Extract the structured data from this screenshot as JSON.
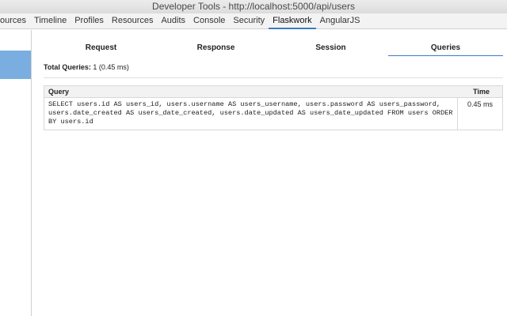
{
  "window": {
    "title": "Developer Tools - http://localhost:5000/api/users"
  },
  "devtools_tabs": [
    {
      "label": "ources",
      "active": false
    },
    {
      "label": "Timeline",
      "active": false
    },
    {
      "label": "Profiles",
      "active": false
    },
    {
      "label": "Resources",
      "active": false
    },
    {
      "label": "Audits",
      "active": false
    },
    {
      "label": "Console",
      "active": false
    },
    {
      "label": "Security",
      "active": false
    },
    {
      "label": "Flaskwork",
      "active": true
    },
    {
      "label": "AngularJS",
      "active": false
    }
  ],
  "panel": {
    "subtabs": [
      {
        "label": "Request",
        "active": false
      },
      {
        "label": "Response",
        "active": false
      },
      {
        "label": "Session",
        "active": false
      },
      {
        "label": "Queries",
        "active": true
      }
    ],
    "summary": {
      "label": "Total Queries:",
      "value": "1 (0.45 ms)"
    },
    "table": {
      "headers": {
        "query": "Query",
        "time": "Time"
      },
      "rows": [
        {
          "query": "SELECT users.id AS users_id, users.username AS users_username, users.password AS users_password, users.date_created AS users_date_created, users.date_updated AS users_date_updated FROM users ORDER BY users.id",
          "time": "0.45 ms"
        }
      ]
    }
  },
  "colors": {
    "accent": "#3b7ac7",
    "selection": "#7aaee0"
  }
}
